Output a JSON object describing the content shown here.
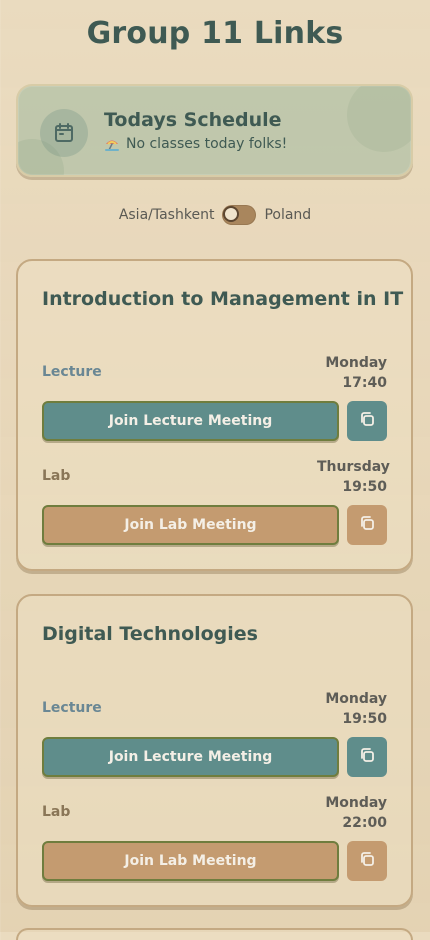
{
  "page": {
    "title": "Group 11 Links"
  },
  "schedule": {
    "title": "Todays Schedule",
    "message": "No classes today folks!",
    "calendar_icon": "calendar-icon",
    "status_icon": "beach-umbrella-icon"
  },
  "timezone": {
    "left_label": "Asia/Tashkent",
    "right_label": "Poland",
    "selected": "Asia/Tashkent"
  },
  "courses": [
    {
      "title": "Introduction to Management in IT",
      "lecture": {
        "label": "Lecture",
        "day": "Monday",
        "time": "17:40",
        "button": "Join Lecture Meeting",
        "copy_icon": "copy-icon"
      },
      "lab": {
        "label": "Lab",
        "day": "Thursday",
        "time": "19:50",
        "button": "Join Lab Meeting",
        "copy_icon": "copy-icon"
      }
    },
    {
      "title": "Digital Technologies",
      "lecture": {
        "label": "Lecture",
        "day": "Monday",
        "time": "19:50",
        "button": "Join Lecture Meeting",
        "copy_icon": "copy-icon"
      },
      "lab": {
        "label": "Lab",
        "day": "Monday",
        "time": "22:00",
        "button": "Join Lab Meeting",
        "copy_icon": "copy-icon"
      }
    }
  ],
  "colors": {
    "background": "#e8d7b8",
    "teal": "#5f8d8b",
    "tan": "#c49b70",
    "title": "#3f5a53"
  }
}
